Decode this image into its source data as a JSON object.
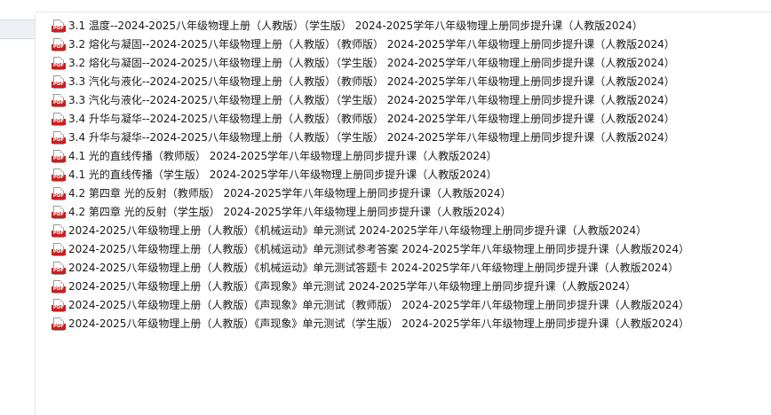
{
  "icon": {
    "name": "pdf-file-icon",
    "label": "PDF",
    "accent": "#c8201f"
  },
  "files": [
    {
      "name": "3.1 温度--2024-2025八年级物理上册（人教版）（学生版） 2024-2025学年八年级物理上册同步提升课（人教版2024）"
    },
    {
      "name": "3.2 熔化与凝固--2024-2025八年级物理上册（人教版）（教师版） 2024-2025学年八年级物理上册同步提升课（人教版2024）"
    },
    {
      "name": "3.2 熔化与凝固--2024-2025八年级物理上册（人教版）（学生版） 2024-2025学年八年级物理上册同步提升课（人教版2024）"
    },
    {
      "name": "3.3 汽化与液化--2024-2025八年级物理上册（人教版）（教师版） 2024-2025学年八年级物理上册同步提升课（人教版2024）"
    },
    {
      "name": "3.3 汽化与液化--2024-2025八年级物理上册（人教版）（学生版） 2024-2025学年八年级物理上册同步提升课（人教版2024）"
    },
    {
      "name": "3.4 升华与凝华--2024-2025八年级物理上册（人教版）（教师版） 2024-2025学年八年级物理上册同步提升课（人教版2024）"
    },
    {
      "name": "3.4 升华与凝华--2024-2025八年级物理上册（人教版）（学生版） 2024-2025学年八年级物理上册同步提升课（人教版2024）"
    },
    {
      "name": "4.1 光的直线传播（教师版） 2024-2025学年八年级物理上册同步提升课（人教版2024）"
    },
    {
      "name": "4.1 光的直线传播（学生版） 2024-2025学年八年级物理上册同步提升课（人教版2024）"
    },
    {
      "name": "4.2 第四章 光的反射（教师版） 2024-2025学年八年级物理上册同步提升课（人教版2024）"
    },
    {
      "name": "4.2 第四章 光的反射（学生版） 2024-2025学年八年级物理上册同步提升课（人教版2024）"
    },
    {
      "name": "2024-2025八年级物理上册（人教版）《机械运动》单元测试 2024-2025学年八年级物理上册同步提升课（人教版2024）"
    },
    {
      "name": "2024-2025八年级物理上册（人教版）《机械运动》单元测试参考答案 2024-2025学年八年级物理上册同步提升课（人教版2024）"
    },
    {
      "name": "2024-2025八年级物理上册（人教版）《机械运动》单元测试答题卡 2024-2025学年八年级物理上册同步提升课（人教版2024）"
    },
    {
      "name": "2024-2025八年级物理上册（人教版）《声现象》单元测试 2024-2025学年八年级物理上册同步提升课（人教版2024）"
    },
    {
      "name": "2024-2025八年级物理上册（人教版）《声现象》单元测试（教师版） 2024-2025学年八年级物理上册同步提升课（人教版2024）"
    },
    {
      "name": "2024-2025八年级物理上册（人教版）《声现象》单元测试（学生版） 2024-2025学年八年级物理上册同步提升课（人教版2024）"
    }
  ]
}
